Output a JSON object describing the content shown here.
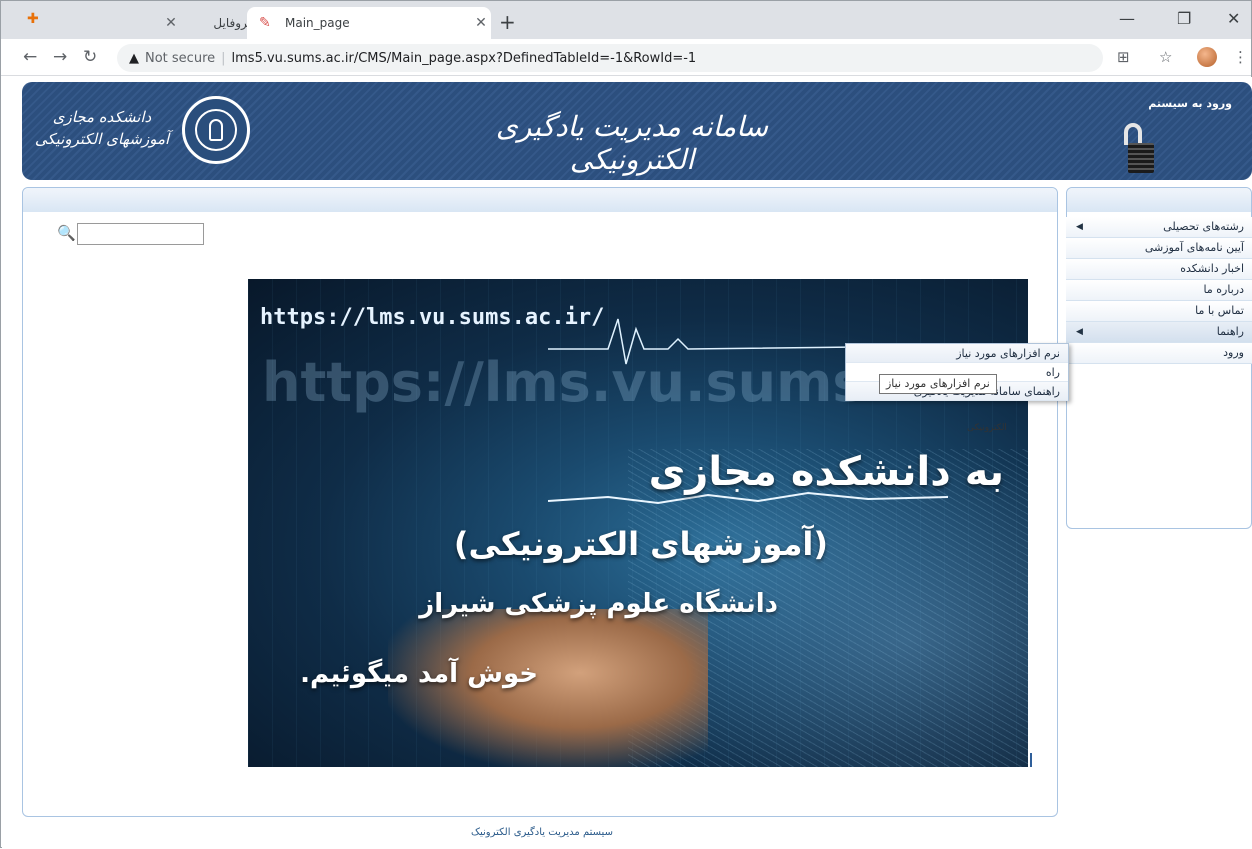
{
  "browser": {
    "tabs": [
      {
        "title": "پروفایل",
        "active": false
      },
      {
        "title": "Main_page",
        "active": true
      }
    ],
    "security_label": "Not secure",
    "url": "lms5.vu.sums.ac.ir/CMS/Main_page.aspx?DefinedTableId=-1&RowId=-1",
    "icons": [
      "back-icon",
      "forward-icon",
      "reload-icon",
      "warning-icon",
      "translate-icon",
      "star-icon",
      "menu-icon"
    ]
  },
  "header": {
    "site_title": "سامانه مدیریت یادگیری الکترونیکی",
    "logo_text_line1": "دانشکده مجازی",
    "logo_text_line2": "آموزشهای الکترونیکی",
    "login_title": "ورود به سیستم",
    "brand_color": "#2c4f7e"
  },
  "search": {
    "value": "",
    "placeholder": ""
  },
  "banner": {
    "url_text": "https://lms.vu.sums.ac.ir/",
    "ghost_text": "https://lms.vu.sums.",
    "line1": "به دانشکده مجازی",
    "line2": "(آموزشهای الکترونیکی)",
    "line3": "دانشگاه علوم پزشکی شیراز",
    "line4": "خوش آمد میگوئیم."
  },
  "menu": {
    "items": [
      {
        "label": "رشته‌های تحصیلی",
        "has_sub": true
      },
      {
        "label": "آیین نامه‌های آموزشی",
        "has_sub": false
      },
      {
        "label": "اخبار دانشکده",
        "has_sub": false
      },
      {
        "label": "درباره ما",
        "has_sub": false
      },
      {
        "label": "تماس با ما",
        "has_sub": false
      },
      {
        "label": "راهنما",
        "has_sub": true
      },
      {
        "label": "ورود",
        "has_sub": false
      }
    ]
  },
  "submenu": {
    "items": [
      {
        "label": "نرم افزارهای مورد نیاز"
      },
      {
        "label": "راه"
      },
      {
        "label": "راهنمای سامانه مدیریت یادگیری"
      }
    ],
    "tooltip": "نرم افزارهای مورد نیاز",
    "obscured_text": "الکترونیکی"
  },
  "footer": {
    "text": "سیستم مدیریت یادگیری الکترونیک"
  }
}
